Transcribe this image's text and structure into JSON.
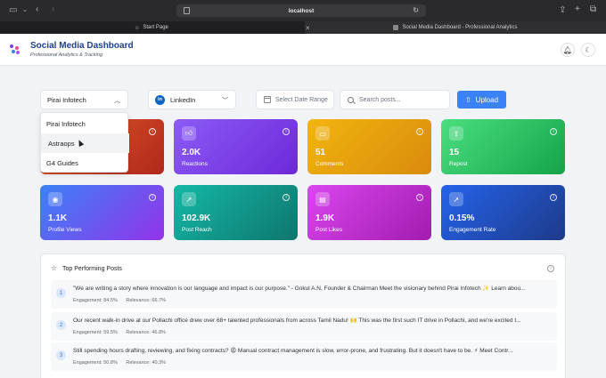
{
  "browser": {
    "url": "localhost",
    "tabs": [
      {
        "label": "Start Page"
      },
      {
        "label": "Social Media Dashboard - Professional Analytics"
      }
    ]
  },
  "header": {
    "title": "Social Media Dashboard",
    "subtitle": "Professional Analytics & Tracking"
  },
  "toolbar": {
    "company_selected": "Pirai Infotech",
    "platform_selected": "LinkedIn",
    "platform_badge": "in",
    "date_placeholder": "Select Date Range",
    "search_placeholder": "Search posts...",
    "upload_label": "Upload"
  },
  "dropdown": {
    "options": [
      "Pirai Infotech",
      "Astraops",
      "G4 Guides"
    ]
  },
  "cards": [
    {
      "value": "2.0K",
      "label": "Reactions",
      "icon": "thumbs-up-icon",
      "color": "#6d28d9"
    },
    {
      "value": "51",
      "label": "Comments",
      "icon": "comment-icon",
      "color": "#e0a10e"
    },
    {
      "value": "15",
      "label": "Repost",
      "icon": "share-icon",
      "color": "#22c55e"
    },
    {
      "value": "1.1K",
      "label": "Profile Views",
      "icon": "eye-icon",
      "color": "#2563eb"
    },
    {
      "value": "102.9K",
      "label": "Post Reach",
      "icon": "trend-icon",
      "color": "#0d9488"
    },
    {
      "value": "1.9K",
      "label": "Post Likes",
      "icon": "message-icon",
      "color": "#c026d3"
    },
    {
      "value": "0.15%",
      "label": "Engagement Rate",
      "icon": "pointer-icon",
      "color": "#1e40af"
    }
  ],
  "top_posts": {
    "title": "Top Performing Posts",
    "items": [
      {
        "rank": "1",
        "text": "\"We are writing a story where innovation is our language and impact is our purpose.\" - Gokul A.N, Founder & Chairman Meet the visionary behind Pirai Infotech ✨ Learn abou...",
        "engagement": "Engagement: 84.5%",
        "relevance": "Relevance: 66.7%"
      },
      {
        "rank": "2",
        "text": "Our recent walk-in drive at our Pollachi office drew over 68+ talented professionals from across Tamil Nadu! 🙌 This was the first such IT drive in Pollachi, and we're excited t...",
        "engagement": "Engagement: 59.5%",
        "relevance": "Relevance: 46.8%"
      },
      {
        "rank": "3",
        "text": "Still spending hours drafting, reviewing, and fixing contracts? 😩 Manual contract management is slow, error-prone, and frustrating. But it doesn't have to be. ⚡ Meet Contr...",
        "engagement": "Engagement: 50.8%",
        "relevance": "Relevance: 40.3%"
      }
    ]
  }
}
